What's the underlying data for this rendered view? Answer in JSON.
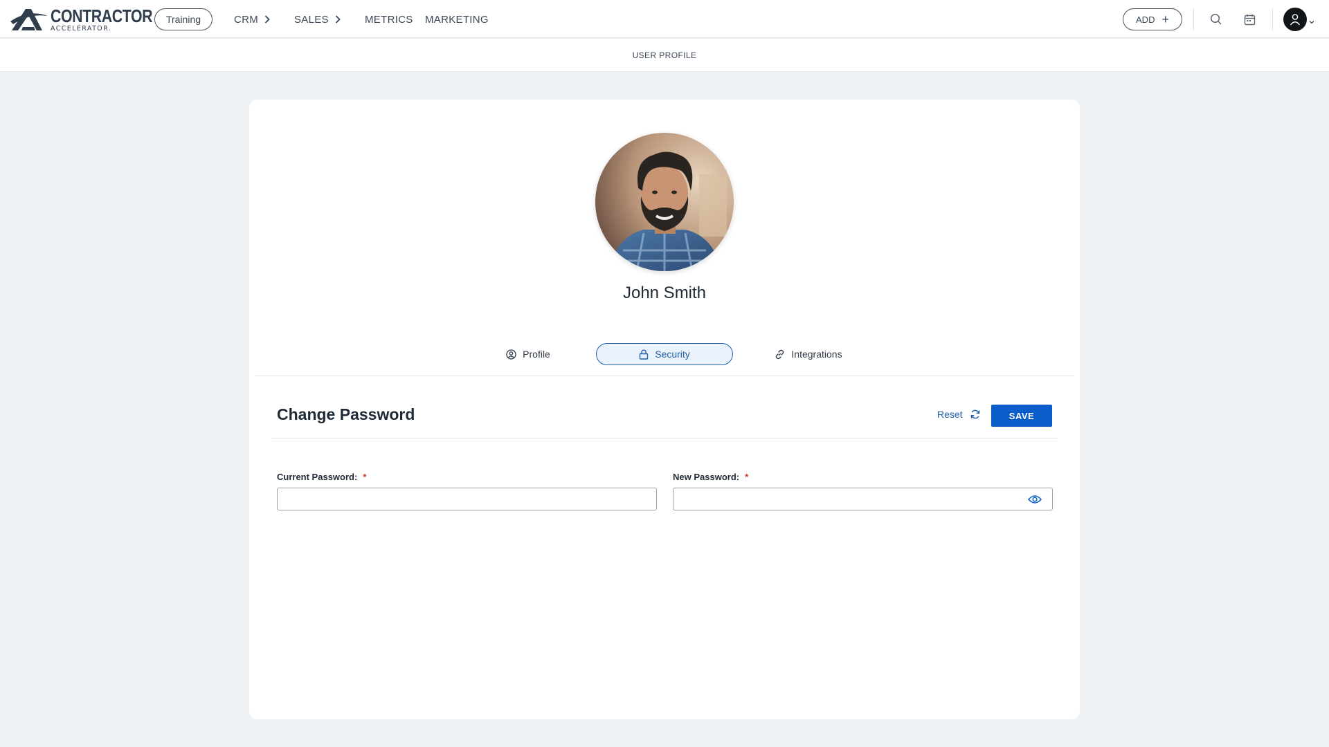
{
  "brand": {
    "name": "CONTRACTOR",
    "tagline": "ACCELERATOR."
  },
  "topnav": {
    "training_label": "Training",
    "items": [
      {
        "label": "CRM",
        "has_submenu": true
      },
      {
        "label": "SALES",
        "has_submenu": true
      },
      {
        "label": "METRICS",
        "has_submenu": false
      },
      {
        "label": "MARKETING",
        "has_submenu": false
      }
    ],
    "add_label": "ADD",
    "icons": [
      "search-icon",
      "calendar-icon",
      "user-icon",
      "chevron-down-icon"
    ]
  },
  "subheader": {
    "title": "USER PROFILE"
  },
  "profile": {
    "name": "John Smith"
  },
  "tabs": [
    {
      "label": "Profile",
      "icon": "user-circle-icon",
      "active": false
    },
    {
      "label": "Security",
      "icon": "lock-icon",
      "active": true
    },
    {
      "label": "Integrations",
      "icon": "link-icon",
      "active": false
    }
  ],
  "section": {
    "title": "Change Password",
    "reset_label": "Reset",
    "save_label": "SAVE"
  },
  "form": {
    "current_password_label": "Current Password:",
    "current_password_value": "",
    "new_password_label": "New Password:",
    "new_password_value": "",
    "required_mark": "*"
  },
  "colors": {
    "accent": "#0b5ec9",
    "active_tab_border": "#1f5ea8",
    "active_tab_bg": "#eaf3fc",
    "required": "#d0342c",
    "page_bg": "#eef1f3"
  }
}
